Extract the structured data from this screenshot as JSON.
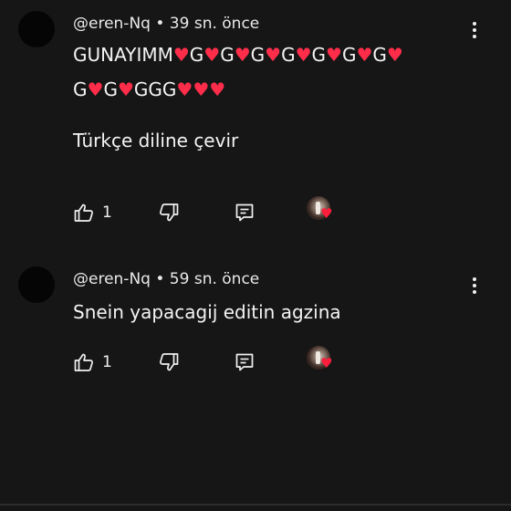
{
  "comments": [
    {
      "author": "@eren-Nq",
      "separator": " • ",
      "time": "39 sn. önce",
      "text_line1": "GUNAYIMM❤️G❤️G❤️G❤️G❤️G❤️G❤️G❤️",
      "text_line2": "G❤️G❤️GGG❤️❤️❤️",
      "translate_label": "Türkçe diline çevir",
      "likes": "1"
    },
    {
      "author": "@eren-Nq",
      "separator": " • ",
      "time": "59 sn. önce",
      "text_line1": "Snein yapacagij editin agzina",
      "likes": "1"
    }
  ],
  "icons": {
    "like": "thumb-up-icon",
    "dislike": "thumb-down-icon",
    "reply": "reply-icon",
    "more": "more-vert-icon",
    "creator_heart": "creator-heart-icon"
  },
  "colors": {
    "background": "#161616",
    "heart": "#ff1e3c",
    "text": "#f1f1f1"
  }
}
